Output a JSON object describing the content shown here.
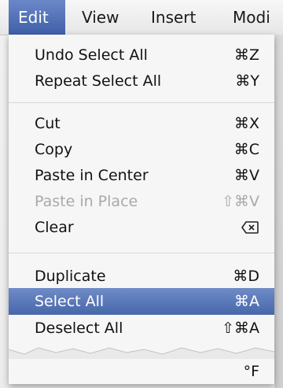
{
  "menubar": {
    "items": [
      "Edit",
      "View",
      "Insert",
      "Modi"
    ]
  },
  "menu": {
    "undo": {
      "label": "Undo Select All",
      "shortcut": "⌘Z"
    },
    "repeat": {
      "label": "Repeat Select All",
      "shortcut": "⌘Y"
    },
    "cut": {
      "label": "Cut",
      "shortcut": "⌘X"
    },
    "copy": {
      "label": "Copy",
      "shortcut": "⌘C"
    },
    "paste_center": {
      "label": "Paste in Center",
      "shortcut": "⌘V"
    },
    "paste_place": {
      "label": "Paste in Place",
      "shortcut": "⇧⌘V"
    },
    "clear": {
      "label": "Clear",
      "icon": "delete-key-icon"
    },
    "duplicate": {
      "label": "Duplicate",
      "shortcut": "⌘D"
    },
    "select_all": {
      "label": "Select All",
      "shortcut": "⌘A"
    },
    "deselect_all": {
      "label": "Deselect All",
      "shortcut": "⇧⌘A"
    },
    "partial": {
      "shortcut": "°F"
    }
  },
  "colors": {
    "highlight": "#4867aa",
    "disabled_text": "#a9a9a9"
  }
}
